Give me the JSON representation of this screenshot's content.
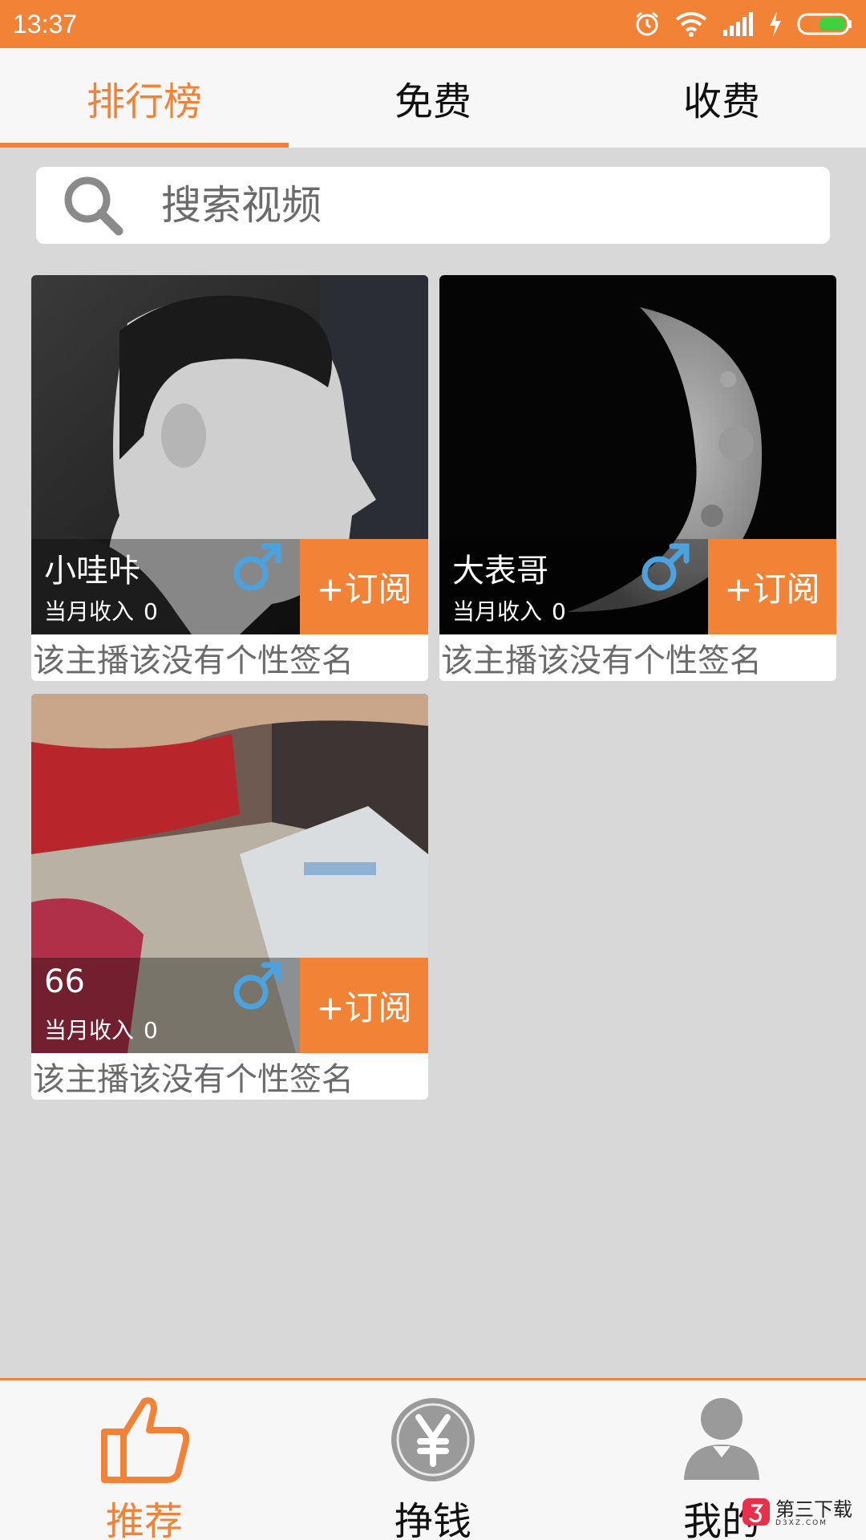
{
  "status_bar": {
    "time": "13:37",
    "icons": [
      "alarm-icon",
      "wifi-icon",
      "signal-icon",
      "charging-icon",
      "battery-icon"
    ]
  },
  "tabs": [
    {
      "label": "排行榜",
      "active": true
    },
    {
      "label": "免费",
      "active": false
    },
    {
      "label": "收费",
      "active": false
    }
  ],
  "search": {
    "placeholder": "搜索视频"
  },
  "cards": [
    {
      "name": "小哇咔",
      "income_label": "当月收入",
      "income_value": "0",
      "gender_icon": "male-icon",
      "subscribe_label": "+订阅",
      "signature": "该主播该没有个性签名"
    },
    {
      "name": "大表哥",
      "income_label": "当月收入",
      "income_value": "0",
      "gender_icon": "male-icon",
      "subscribe_label": "+订阅",
      "signature": "该主播该没有个性签名"
    },
    {
      "name": "66",
      "income_label": "当月收入",
      "income_value": "0",
      "gender_icon": "male-icon",
      "subscribe_label": "+订阅",
      "signature": "该主播该没有个性签名"
    }
  ],
  "bottom_nav": [
    {
      "label": "推荐",
      "icon": "thumbs-up-icon",
      "active": true
    },
    {
      "label": "挣钱",
      "icon": "yen-coin-icon",
      "active": false
    },
    {
      "label": "我的",
      "icon": "user-icon",
      "active": false
    }
  ],
  "watermark": {
    "text": "第三下载",
    "sub": "D3XZ.COM"
  },
  "colors": {
    "accent": "#f28236",
    "background": "#d8d8d8",
    "gender_blue": "#4aa3df"
  }
}
